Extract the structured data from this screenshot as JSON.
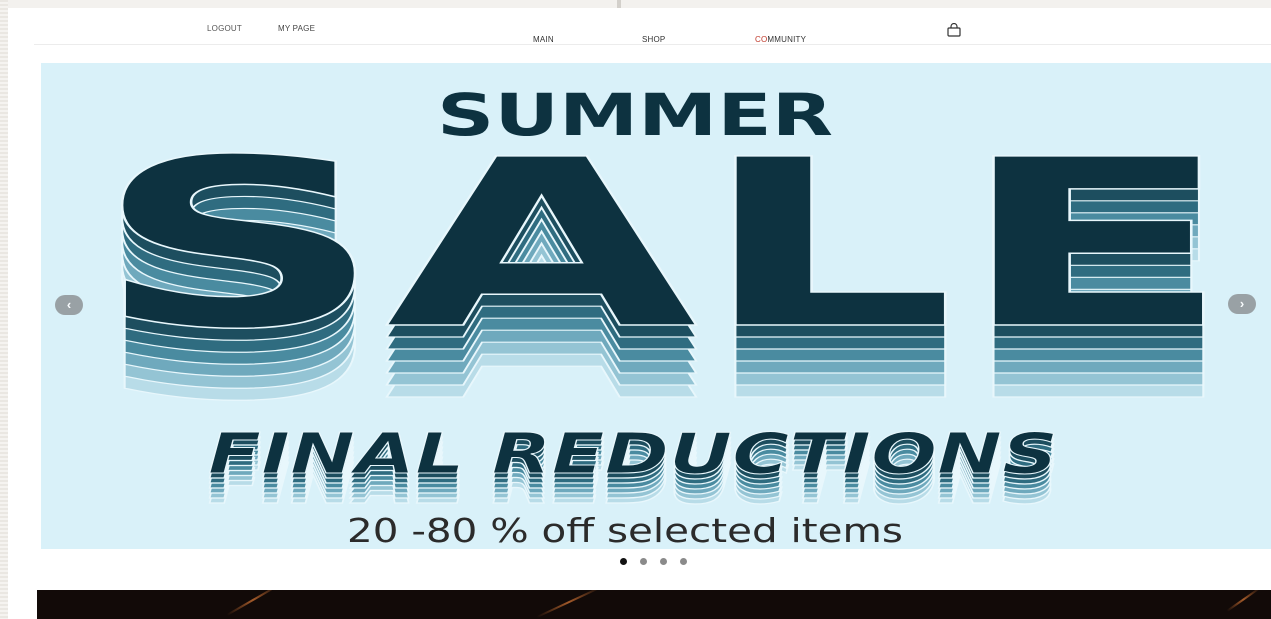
{
  "header": {
    "logout_label": "LOGOUT",
    "mypage_label": "MY PAGE",
    "nav": [
      {
        "label": "MAIN"
      },
      {
        "label": "SHOP"
      },
      {
        "label_accent": "CO",
        "label_rest": "MMUNITY"
      }
    ],
    "cart_icon": "shopping-bag-icon"
  },
  "banner": {
    "line1": "SUMMER",
    "line2": "SALE",
    "line3": "FINAL REDUCTIONS",
    "line4": "20 -80 % off selected items",
    "colors": {
      "background": "#d9f1f9",
      "headline": "#0d3240",
      "shadow_layers": [
        "#1d4e5f",
        "#2f6c80",
        "#4a8ba0",
        "#6fa9bd",
        "#94c4d4",
        "#b8dce8"
      ],
      "subtext": "#2b2b2b"
    }
  },
  "carousel": {
    "prev_icon": "chevron-left-icon",
    "next_icon": "chevron-right-icon",
    "prev_glyph": "‹",
    "next_glyph": "›",
    "slide_count": 4,
    "active_index": 0
  },
  "colors": {
    "page_bg": "#f3f1ee",
    "dark_band": "#120a08"
  }
}
